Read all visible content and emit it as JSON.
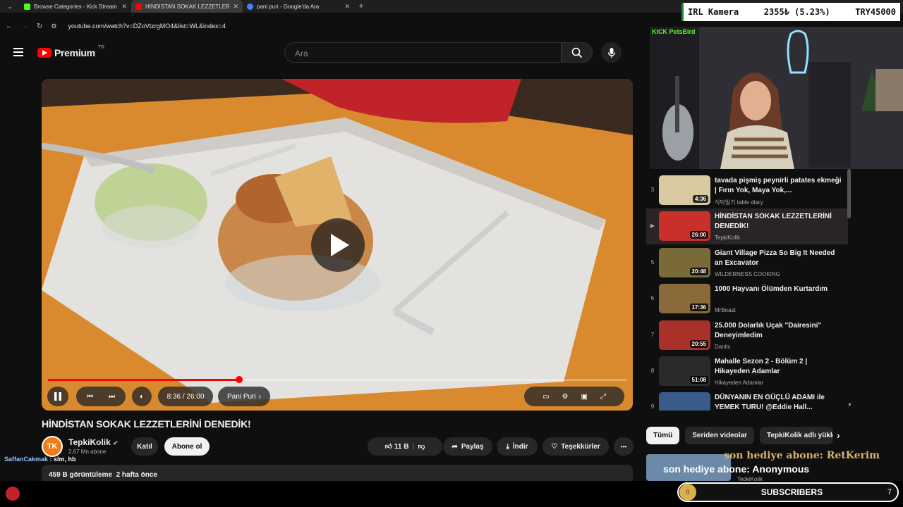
{
  "browser": {
    "tabs": [
      {
        "title": "Browse Categories - Kick Stream",
        "favicon_color": "#53fc18"
      },
      {
        "title": "HİNDİSTAN SOKAK LEZZETLERİ",
        "favicon_color": "#ff0000"
      },
      {
        "title": "pani puri - Google'da Ara",
        "favicon_color": "#4285f4"
      }
    ],
    "url": "youtube.com/watch?v=DZoVtzrgMO4&list=WL&index=4",
    "new_tab_label": "+"
  },
  "overlay": {
    "irl_label": "IRL Kamera",
    "irl_change": "2355₺ (5.23%)",
    "irl_goal": "TRY45000",
    "kick_label": "KICK PetsBird",
    "chat_user": "SaffanCakmak",
    "chat_text": " : slm, hb",
    "alert_line1": "son hediye abone: RetKerim",
    "alert_line2": "son hediye abone: Anonymous",
    "subs_count": "0",
    "subs_label": "SUBSCRIBERS",
    "subs_goal": "7"
  },
  "youtube": {
    "logo_text": "Premium",
    "logo_sup": "TR",
    "search_placeholder": "Ara",
    "player": {
      "current_time": "8:36",
      "duration": "26:00",
      "time_label": "8:36 / 26:00",
      "chapter": "Pani Puri",
      "progress_fraction": 0.331
    },
    "video_title": "HİNDİSTAN SOKAK LEZZETLERİNİ DENEDİK!",
    "channel": {
      "avatar_text": "TK",
      "name": "TepkiKolik",
      "subscribers": "2,67 Mn abone",
      "join_label": "Katıl",
      "subscribe_label": "Abone ol"
    },
    "actions": {
      "likes": "11 B",
      "share": "Paylaş",
      "download": "İndir",
      "thanks": "Teşekkürler",
      "more": "•••"
    },
    "description": {
      "views": "459 B görüntüleme",
      "age": "2 hafta önce"
    },
    "playlist": [
      {
        "index": "3",
        "title": "tavada pişmiş peynirli patates ekmeği | Fırın Yok, Maya Yok,...",
        "channel": "식탁일기 table diary",
        "duration": "4:36",
        "thumb_color": "#d9c9a0"
      },
      {
        "index": "▶",
        "title": "HİNDİSTAN SOKAK LEZZETLERİNİ DENEDİK!",
        "channel": "TepkiKolik",
        "duration": "26:00",
        "thumb_color": "#c9302c"
      },
      {
        "index": "5",
        "title": "Giant Village Pizza So Big It Needed an Excavator",
        "channel": "WILDERNESS COOKING",
        "duration": "20:48",
        "thumb_color": "#7a6a3a"
      },
      {
        "index": "6",
        "title": "1000 Hayvanı Ölümden Kurtardım",
        "channel": "MrBeast",
        "duration": "17:36",
        "thumb_color": "#8a6a3a"
      },
      {
        "index": "7",
        "title": "25.000 Dolarlık Uçak \"Dairesini\" Deneyimledim",
        "channel": "Dantic",
        "duration": "20:55",
        "thumb_color": "#a8322a"
      },
      {
        "index": "8",
        "title": "Mahalle Sezon 2 - Bölüm 2 | Hikayeden Adamlar",
        "channel": "Hikayeden Adamlar",
        "duration": "51:08",
        "thumb_color": "#2a2a2a"
      },
      {
        "index": "9",
        "title": "DÜNYANIN EN GÜÇLÜ ADAMI ile YEMEK TURU! @Eddie Hall...",
        "channel": "",
        "duration": "25:46",
        "thumb_color": "#3a5a8a"
      }
    ],
    "chips": [
      "Tümü",
      "Seriden videolar",
      "TepkiKolik adlı yükle"
    ],
    "next_channel": "TepkiKolik"
  }
}
